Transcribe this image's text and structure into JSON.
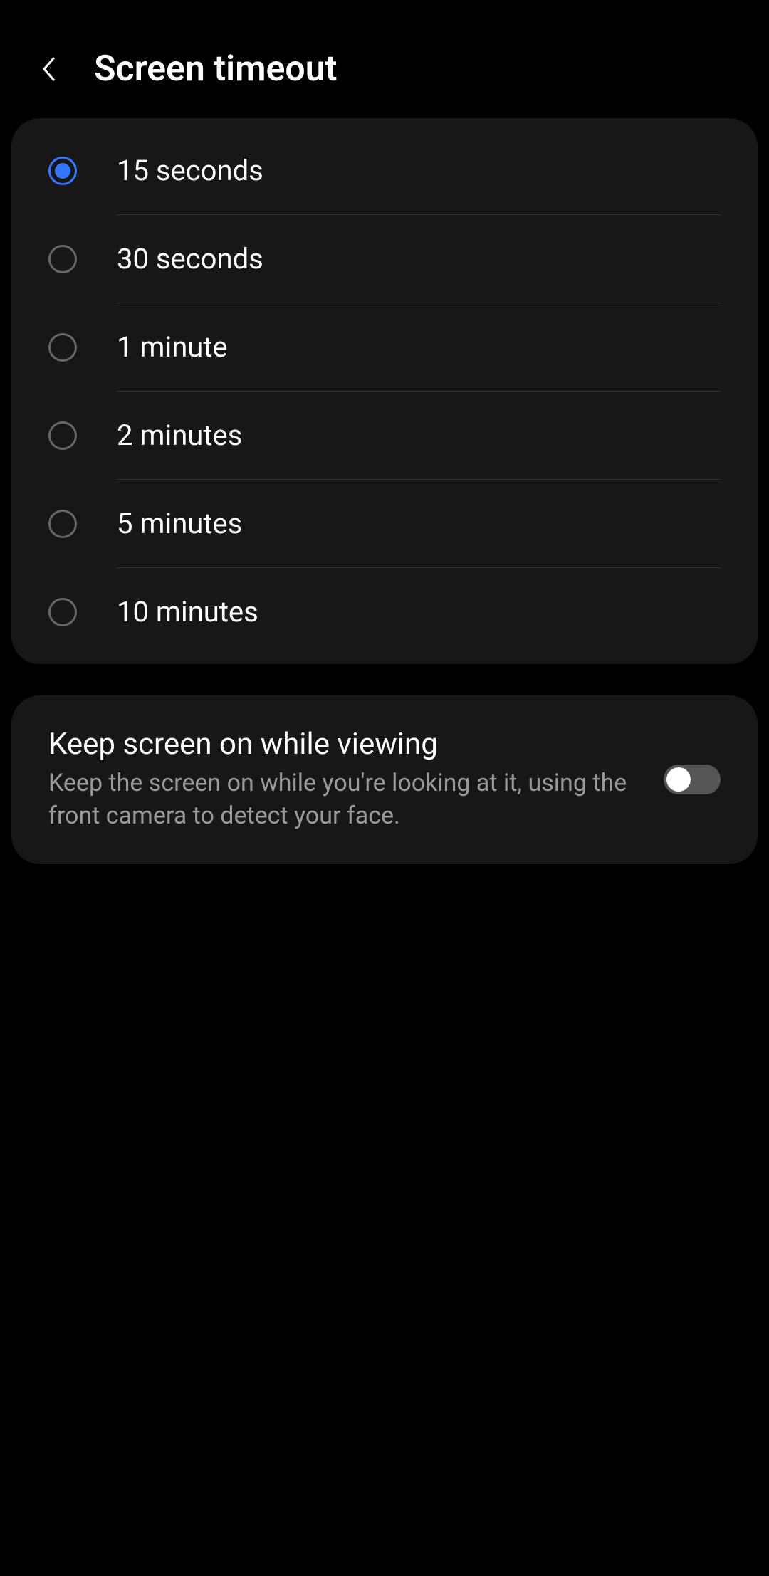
{
  "header": {
    "title": "Screen timeout"
  },
  "options": [
    {
      "label": "15 seconds",
      "selected": true
    },
    {
      "label": "30 seconds",
      "selected": false
    },
    {
      "label": "1 minute",
      "selected": false
    },
    {
      "label": "2 minutes",
      "selected": false
    },
    {
      "label": "5 minutes",
      "selected": false
    },
    {
      "label": "10 minutes",
      "selected": false
    }
  ],
  "keepOn": {
    "title": "Keep screen on while viewing",
    "description": "Keep the screen on while you're looking at it, using the front camera to detect your face.",
    "enabled": false
  }
}
